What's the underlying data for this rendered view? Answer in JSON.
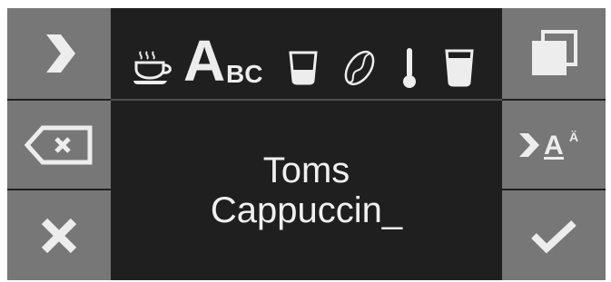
{
  "left_buttons": [
    {
      "name": "next-button",
      "icon": "chevron-right-icon"
    },
    {
      "name": "backspace-button",
      "icon": "backspace-icon"
    },
    {
      "name": "cancel-button",
      "icon": "close-x-icon"
    }
  ],
  "right_buttons": [
    {
      "name": "copy-button",
      "icon": "copy-stack-icon"
    },
    {
      "name": "next-character-set-button",
      "icon": "chevron-right-accent-letter-icon",
      "letter": "A",
      "accent_letter": "Ä"
    },
    {
      "name": "confirm-button",
      "icon": "checkmark-icon"
    }
  ],
  "icon_bar": {
    "icons": [
      "cup-icon",
      "text-name-icon",
      "glass-small-icon",
      "coffee-bean-icon",
      "thermometer-icon",
      "glass-large-icon"
    ],
    "text_icon_big": "A",
    "text_icon_small": "BC"
  },
  "entry": {
    "line1": "Toms",
    "line2": "Cappuccin_"
  },
  "colors": {
    "screen": "#1f1f1f",
    "button": "#777777",
    "icon": "#ededed",
    "text": "#f0f0f0"
  }
}
